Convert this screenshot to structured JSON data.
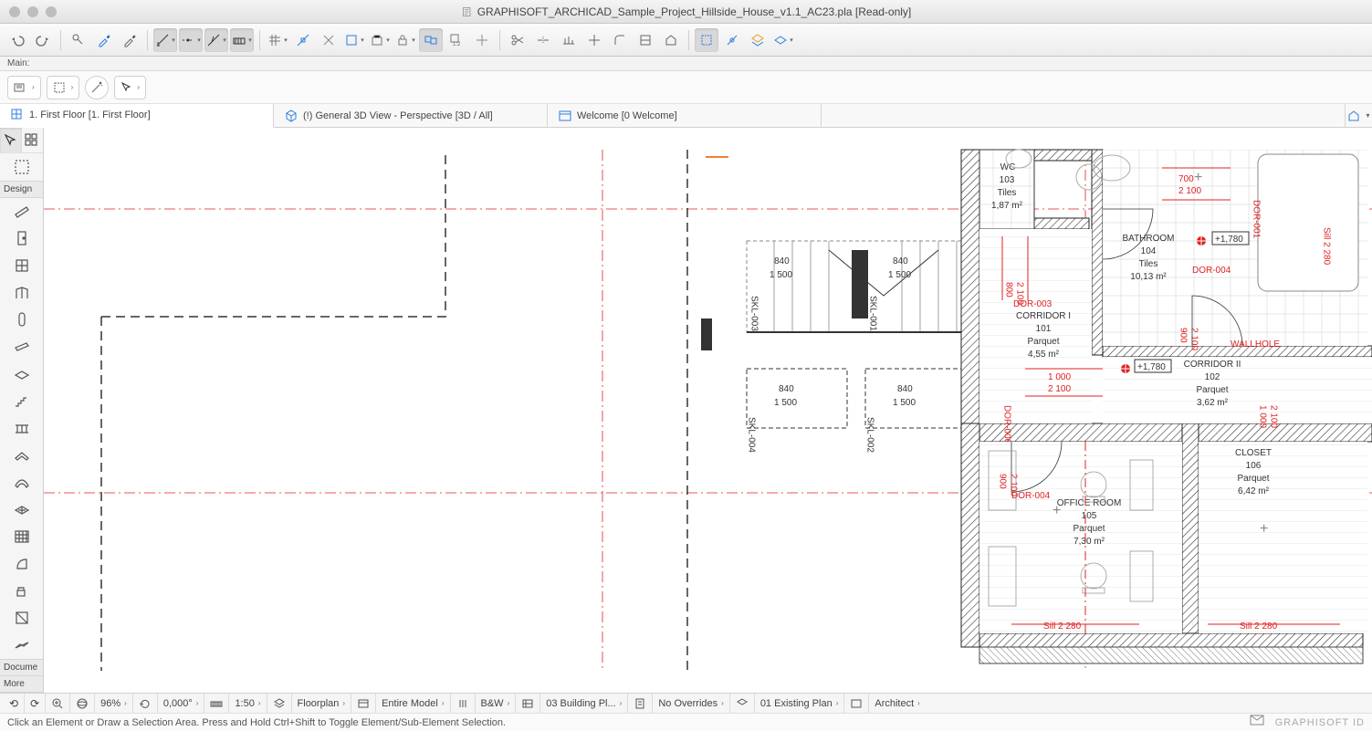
{
  "window": {
    "title": "GRAPHISOFT_ARCHICAD_Sample_Project_Hillside_House_v1.1_AC23.pla [Read-only]"
  },
  "main_label": "Main:",
  "tabs": [
    {
      "label": "1. First Floor [1. First Floor]"
    },
    {
      "label": "(!) General 3D View - Perspective [3D / All]"
    },
    {
      "label": "Welcome [0 Welcome]"
    }
  ],
  "toolbox": {
    "section_design": "Design",
    "section_docume": "Docume",
    "section_more": "More"
  },
  "navbar": {
    "zoom": "96%",
    "angle": "0,000°",
    "scale": "1:50",
    "layer": "Floorplan",
    "model": "Entire Model",
    "pen": "B&W",
    "building": "03 Building Pl...",
    "overrides": "No Overrides",
    "plan": "01 Existing Plan",
    "role": "Architect"
  },
  "status": {
    "hint": "Click an Element or Draw a Selection Area. Press and Hold Ctrl+Shift to Toggle Element/Sub-Element Selection.",
    "brand": "GRAPHISOFT ID"
  },
  "rooms": {
    "wc": {
      "name": "WC",
      "num": "103",
      "mat": "Tiles",
      "area": "1,87 m²"
    },
    "bathroom": {
      "name": "BATHROOM",
      "num": "104",
      "mat": "Tiles",
      "area": "10,13 m²"
    },
    "corridor1": {
      "name": "CORRIDOR I",
      "num": "101",
      "mat": "Parquet",
      "area": "4,55 m²"
    },
    "corridor2": {
      "name": "CORRIDOR II",
      "num": "102",
      "mat": "Parquet",
      "area": "3,62 m²"
    },
    "closet": {
      "name": "CLOSET",
      "num": "106",
      "mat": "Parquet",
      "area": "6,42 m²"
    },
    "office": {
      "name": "OFFICE ROOM",
      "num": "105",
      "mat": "Parquet",
      "area": "7,30 m²"
    }
  },
  "annotations": {
    "elev1": "+1,780",
    "elev2": "+1,780",
    "dor001": "DOR-001",
    "dor003": "DOR-003",
    "dor004a": "DOR-004",
    "dor004b": "DOR-004",
    "dor006": "DOR-006",
    "wallhole": "WALLHOLE",
    "sill1": "Sill 2 280",
    "sill2": "Sill 2 280",
    "sill3": "Sill 2 280",
    "d700": "700",
    "d2100a": "2 100",
    "d800": "800",
    "d2100b": "2 100",
    "d900a": "900",
    "d2100c": "2 100",
    "d1000a": "1 000",
    "d2100d": "2 100",
    "d1000b": "1 000",
    "d2100e": "2 100",
    "d900b": "900",
    "d2100f": "2 100",
    "skl002": "SKL-002",
    "skl002_a": "840",
    "skl002_b": "1 500",
    "skl003": "SKL-003",
    "skl003_a": "840",
    "skl003_b": "1 500",
    "skl004": "SKL-004",
    "skl004_a": "840",
    "skl004_b": "1 500",
    "skl001": "SKL-001",
    "skl001_a": "840",
    "skl001_b": "1 500"
  }
}
